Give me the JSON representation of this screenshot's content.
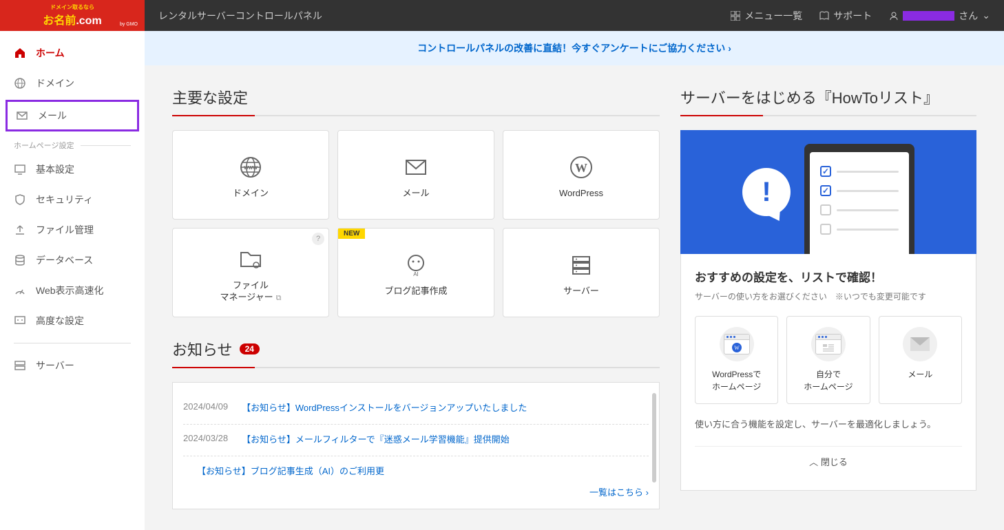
{
  "header": {
    "logo_tagline": "ドメイン取るなら",
    "logo_text_1": "お名前",
    "logo_text_2": ".com",
    "logo_sub": "by GMO",
    "title": "レンタルサーバーコントロールパネル",
    "menu_list": "メニュー一覧",
    "support": "サポート",
    "user_suffix": "さん"
  },
  "banner": {
    "text": "コントロールパネルの改善に直結！今すぐアンケートにご協力ください ›"
  },
  "sidebar": {
    "home": "ホーム",
    "domain": "ドメイン",
    "mail": "メール",
    "section_hp": "ホームページ設定",
    "basic": "基本設定",
    "security": "セキュリティ",
    "file": "ファイル管理",
    "database": "データベース",
    "speed": "Web表示高速化",
    "advanced": "高度な設定",
    "server": "サーバー"
  },
  "main_settings": {
    "title": "主要な設定",
    "cards": {
      "domain": "ドメイン",
      "mail": "メール",
      "wordpress": "WordPress",
      "file_manager": "ファイル\nマネージャー",
      "blog_ai": "ブログ記事作成",
      "server": "サーバー",
      "new_badge": "NEW"
    }
  },
  "news": {
    "title": "お知らせ",
    "count": "24",
    "items": [
      {
        "date": "2024/04/09",
        "title": "【お知らせ】WordPressインストールをバージョンアップいたしました"
      },
      {
        "date": "2024/03/28",
        "title": "【お知らせ】メールフィルターで『迷惑メール学習機能』提供開始"
      },
      {
        "date": "",
        "title": "【お知らせ】ブログ記事生成（AI）のご利用更"
      }
    ],
    "more": "一覧はこちら ›"
  },
  "howto": {
    "title": "サーバーをはじめる『HowToリスト』",
    "heading": "おすすめの設定を、リストで確認！",
    "sub": "サーバーの使い方をお選びください　※いつでも変更可能です",
    "options": {
      "wp": "WordPressで\nホームページ",
      "self": "自分で\nホームページ",
      "mail": "メール"
    },
    "desc": "使い方に合う機能を設定し、サーバーを最適化しましょう。",
    "close": "閉じる"
  }
}
